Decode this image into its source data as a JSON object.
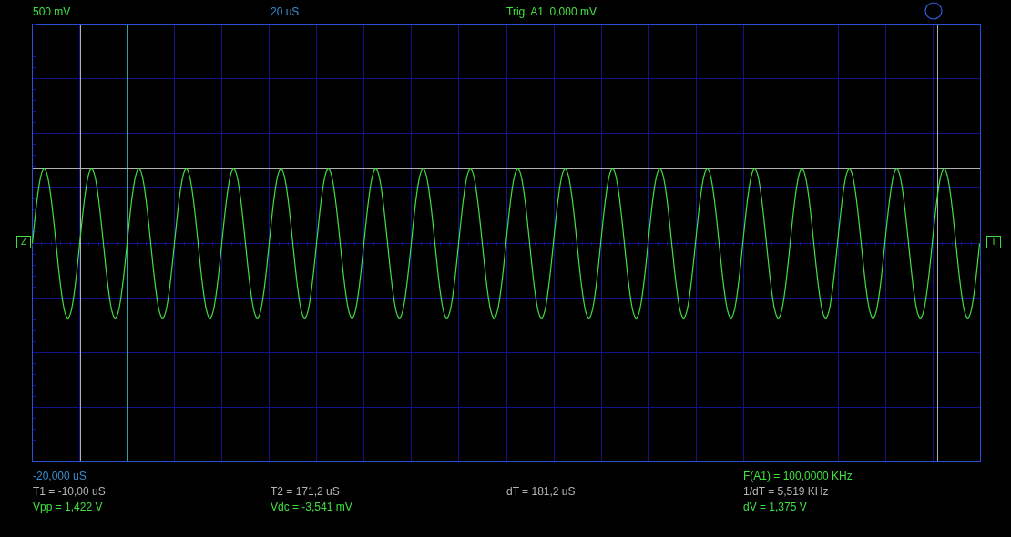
{
  "header": {
    "volts_per_div": "500 mV",
    "time_per_div": "20 uS",
    "trigger": "Trig. A1  0,000 mV"
  },
  "markers": {
    "ground": "Z",
    "trigger": "T"
  },
  "readouts": {
    "start_time": {
      "text": "-20,000 uS",
      "color": "#3a8fd0"
    },
    "frequency": {
      "text": "F(A1) = 100,0000 KHz",
      "color": "#40e040"
    },
    "t1": {
      "text": "T1 = -10,00 uS",
      "color": "#b4b4b4"
    },
    "t2": {
      "text": "T2 = 171,2 uS",
      "color": "#b4b4b4"
    },
    "dt": {
      "text": "dT = 181,2 uS",
      "color": "#b4b4b4"
    },
    "inv_dt": {
      "text": "1/dT = 5,519 KHz",
      "color": "#b4b4b4"
    },
    "vpp": {
      "text": "Vpp = 1,422 V",
      "color": "#40e040"
    },
    "vdc": {
      "text": "Vdc = -3,541 mV",
      "color": "#40e040"
    },
    "dv": {
      "text": "dV = 1,375 V",
      "color": "#40e040"
    }
  }
}
